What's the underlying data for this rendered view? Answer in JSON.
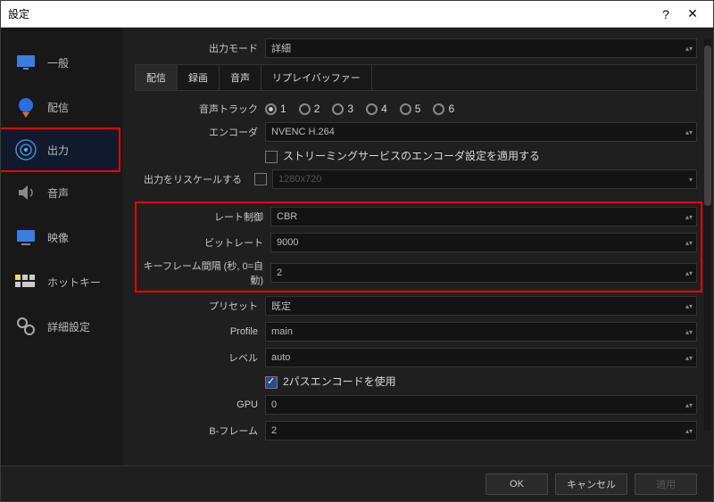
{
  "titlebar": {
    "title": "設定"
  },
  "sidebar": {
    "items": [
      {
        "label": "一般"
      },
      {
        "label": "配信"
      },
      {
        "label": "出力"
      },
      {
        "label": "音声"
      },
      {
        "label": "映像"
      },
      {
        "label": "ホットキー"
      },
      {
        "label": "詳細設定"
      }
    ]
  },
  "top": {
    "output_mode_label": "出力モード",
    "output_mode_value": "詳細"
  },
  "tabs": {
    "items": [
      {
        "label": "配信"
      },
      {
        "label": "録画"
      },
      {
        "label": "音声"
      },
      {
        "label": "リプレイバッファー"
      }
    ]
  },
  "tracks": {
    "label": "音声トラック",
    "options": [
      "1",
      "2",
      "3",
      "4",
      "5",
      "6"
    ]
  },
  "encoder": {
    "label": "エンコーダ",
    "value": "NVENC H.264"
  },
  "enforce": {
    "label": "ストリーミングサービスのエンコーダ設定を適用する"
  },
  "rescale": {
    "label": "出力をリスケールする",
    "value": "1280x720"
  },
  "ratectl": {
    "label": "レート制御",
    "value": "CBR"
  },
  "bitrate": {
    "label": "ビットレート",
    "value": "9000"
  },
  "keyframe": {
    "label": "キーフレーム間隔 (秒, 0=自動)",
    "value": "2"
  },
  "preset": {
    "label": "プリセット",
    "value": "既定"
  },
  "profile": {
    "label": "Profile",
    "value": "main"
  },
  "level": {
    "label": "レベル",
    "value": "auto"
  },
  "twopass": {
    "label": "2パスエンコードを使用"
  },
  "gpu": {
    "label": "GPU",
    "value": "0"
  },
  "bframes": {
    "label": "B-フレーム",
    "value": "2"
  },
  "footer": {
    "ok": "OK",
    "cancel": "キャンセル",
    "apply": "適用"
  }
}
